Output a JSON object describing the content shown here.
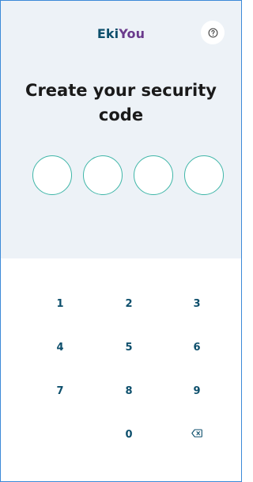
{
  "header": {
    "brand_part1": "Eki",
    "brand_part2": "You",
    "help_icon": "question-circle-icon"
  },
  "main": {
    "title": "Create your security code",
    "pin_length": 4
  },
  "keypad": {
    "keys": [
      "1",
      "2",
      "3",
      "4",
      "5",
      "6",
      "7",
      "8",
      "9",
      "",
      "0",
      "⌫"
    ],
    "backspace_icon": "backspace-icon"
  },
  "colors": {
    "brand_primary": "#0d4f6c",
    "brand_secondary": "#6a3a8c",
    "panel_background": "#edf2f7",
    "pin_border": "#3fb6a8"
  }
}
